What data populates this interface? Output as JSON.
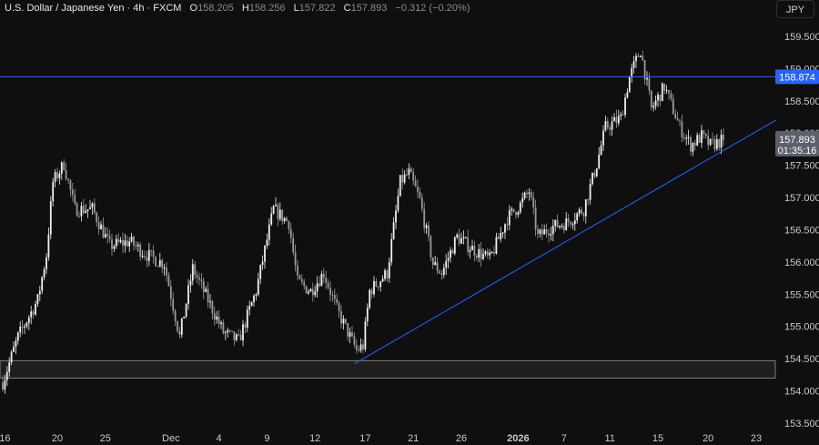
{
  "header": {
    "symbol": "U.S. Dollar / Japanese Yen · 4h · FXCM",
    "o_label": "O",
    "o_value": "158.205",
    "h_label": "H",
    "h_value": "158.256",
    "l_label": "L",
    "l_value": "157.822",
    "c_label": "C",
    "c_value": "157.893",
    "change": "−0.312 (−0.20%)"
  },
  "currency_button": "JPY",
  "colors": {
    "background": "#0f0f0f",
    "up": "#efefef",
    "down": "#9a9a9a",
    "line": "#2962ff",
    "zone": "#1e1e1e"
  },
  "chart_data": {
    "type": "candlestick",
    "title": "U.S. Dollar / Japanese Yen · 4h · FXCM",
    "ylim": [
      153.3,
      159.75
    ],
    "y_ticks": [
      "159.500",
      "159.000",
      "158.500",
      "158.000",
      "157.500",
      "157.000",
      "156.500",
      "156.000",
      "155.500",
      "155.000",
      "154.500",
      "154.000",
      "153.500"
    ],
    "x_ticks": [
      {
        "label": "16",
        "bar": 1
      },
      {
        "label": "20",
        "bar": 25
      },
      {
        "label": "25",
        "bar": 47
      },
      {
        "label": "Dec",
        "bar": 77
      },
      {
        "label": "4",
        "bar": 99
      },
      {
        "label": "9",
        "bar": 121
      },
      {
        "label": "12",
        "bar": 143
      },
      {
        "label": "17",
        "bar": 166
      },
      {
        "label": "21",
        "bar": 188
      },
      {
        "label": "26",
        "bar": 210
      },
      {
        "label": "2026",
        "bar": 236
      },
      {
        "label": "7",
        "bar": 257
      },
      {
        "label": "11",
        "bar": 278
      },
      {
        "label": "15",
        "bar": 300
      },
      {
        "label": "20",
        "bar": 323
      },
      {
        "label": "23",
        "bar": 345
      }
    ],
    "price_path": [
      [
        0,
        154.13
      ],
      [
        7,
        154.84
      ],
      [
        16,
        155.41
      ],
      [
        20,
        156.11
      ],
      [
        23,
        157.24
      ],
      [
        28,
        157.52
      ],
      [
        33,
        156.82
      ],
      [
        41,
        156.82
      ],
      [
        49,
        156.25
      ],
      [
        58,
        156.32
      ],
      [
        66,
        156.11
      ],
      [
        74,
        155.97
      ],
      [
        81,
        154.84
      ],
      [
        87,
        155.9
      ],
      [
        93,
        155.48
      ],
      [
        101,
        154.91
      ],
      [
        108,
        154.77
      ],
      [
        116,
        155.55
      ],
      [
        124,
        156.82
      ],
      [
        131,
        156.61
      ],
      [
        135,
        155.69
      ],
      [
        141,
        155.55
      ],
      [
        147,
        155.83
      ],
      [
        153,
        155.26
      ],
      [
        162,
        154.63
      ],
      [
        165,
        154.7
      ],
      [
        168,
        155.55
      ],
      [
        176,
        155.83
      ],
      [
        182,
        157.24
      ],
      [
        186,
        157.38
      ],
      [
        191,
        156.96
      ],
      [
        197,
        155.97
      ],
      [
        201,
        155.83
      ],
      [
        208,
        156.39
      ],
      [
        216,
        156.18
      ],
      [
        223,
        156.04
      ],
      [
        231,
        156.68
      ],
      [
        237,
        156.89
      ],
      [
        241,
        157.1
      ],
      [
        245,
        156.39
      ],
      [
        251,
        156.54
      ],
      [
        258,
        156.61
      ],
      [
        266,
        156.82
      ],
      [
        272,
        157.52
      ],
      [
        276,
        158.09
      ],
      [
        283,
        158.23
      ],
      [
        287,
        158.87
      ],
      [
        292,
        159.29
      ],
      [
        294,
        158.94
      ],
      [
        297,
        158.37
      ],
      [
        303,
        158.72
      ],
      [
        310,
        158.09
      ],
      [
        315,
        157.81
      ],
      [
        320,
        157.95
      ],
      [
        324,
        157.81
      ],
      [
        330,
        157.893
      ]
    ],
    "horizontal_line": {
      "price": 158.874,
      "label": "158.874"
    },
    "support_zone": [
      154.2,
      154.47
    ],
    "trendline": [
      [
        161,
        154.42
      ],
      [
        354,
        158.2
      ]
    ],
    "last_price": {
      "label": "157.893",
      "countdown": "01:35:16"
    }
  }
}
